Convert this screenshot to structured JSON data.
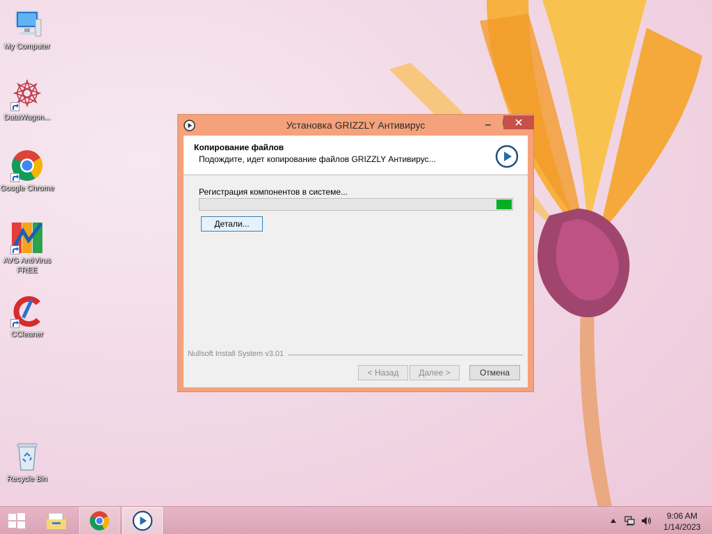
{
  "desktop": {
    "icons": [
      {
        "label": "My Computer"
      },
      {
        "label": "DataWagon..."
      },
      {
        "label": "Google Chrome"
      },
      {
        "label": "AVG AntiVirus FREE"
      },
      {
        "label": "CCleaner"
      },
      {
        "label": "Recycle Bin"
      }
    ]
  },
  "installer": {
    "title": "Установка GRIZZLY Антивирус",
    "header_title": "Копирование файлов",
    "header_subtitle": "Подождите, идет копирование файлов GRIZZLY Антивирус...",
    "status": "Регистрация компонентов в системе...",
    "progress": 0.05,
    "details_label": "Детали...",
    "branding": "Nullsoft Install System v3.01",
    "back_label": "< Назад",
    "next_label": "Далее >",
    "cancel_label": "Отмена"
  },
  "taskbar": {
    "clock_time": "9:06 AM",
    "clock_date": "1/14/2023"
  },
  "colors": {
    "window_frame": "#f5a27c",
    "progress_fill": "#06b025",
    "close_button": "#c7504a",
    "taskbar": "#e0adbf"
  }
}
